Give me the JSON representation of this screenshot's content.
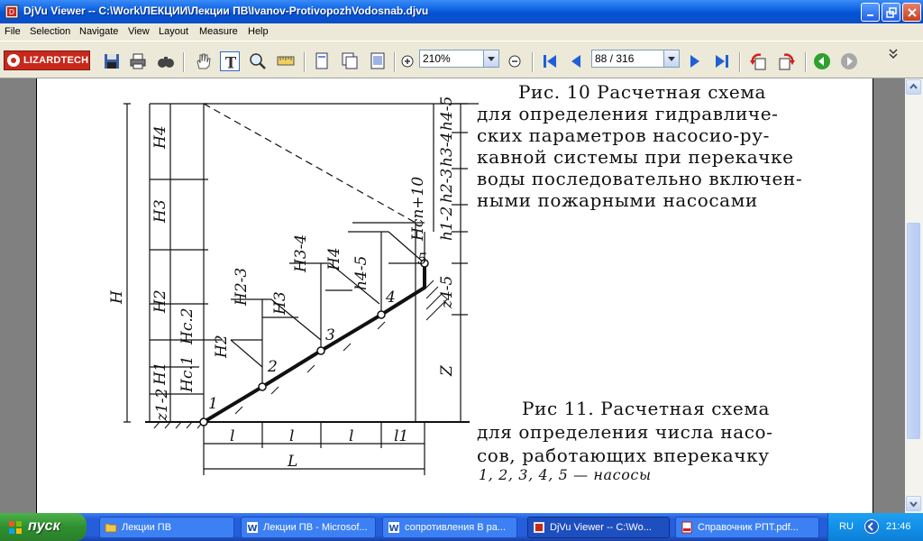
{
  "window": {
    "title": "DjVu Viewer -- C:\\Work\\ЛЕКЦИИ\\Лекции ПВ\\Ivanov-ProtivopozhVodosnab.djvu"
  },
  "menu": [
    "File",
    "Selection",
    "Navigate",
    "View",
    "Layout",
    "Measure",
    "Help"
  ],
  "toolbar": {
    "logo_text": "LIZARDTECH",
    "zoom_value": "210%",
    "page_value": "88 / 316"
  },
  "document": {
    "fig10_caption": [
      "Рис. 10  Расчетная схема",
      "для определения гидравличе-",
      "ских параметров насосио-ру-",
      "кавной системы при перекачке",
      "воды последовательно включен-",
      "ными пожарными насосами"
    ],
    "fig11_caption": [
      "Рис 11.  Расчетная схема",
      "для определения  числа насо-",
      "сов, работающих вперекачку"
    ],
    "fig11_note": "1, 2, 3, 4, 5 — насосы",
    "diagram": {
      "left_labels": [
        "H4",
        "H3",
        "H2",
        "Hc.2",
        "H1",
        "Hc.1",
        "z1-2",
        "H"
      ],
      "middle_labels": [
        "H2",
        "H2-3",
        "H3",
        "H3-4",
        "H4",
        "h4-5",
        "Hсп+10"
      ],
      "right_labels": [
        "h4-5",
        "h3-4",
        "h2-3",
        "h1-2",
        "z4-5",
        "Z"
      ],
      "pump_labels": [
        "1",
        "2",
        "3",
        "4",
        "5"
      ],
      "bottom_labels": [
        "l",
        "l",
        "l",
        "l1",
        "L"
      ]
    }
  },
  "taskbar": {
    "start_label": "пуск",
    "tasks": [
      "Лекции ПВ",
      "Лекции ПВ - Microsof...",
      "сопротивления В ра...",
      "DjVu Viewer -- C:\\Wo...",
      "Справочник РПТ.pdf..."
    ],
    "language": "RU",
    "clock": "21:46"
  },
  "colors": {
    "title_blue": "#0a5fe0",
    "taskbar_blue": "#245edb",
    "start_green": "#2f8f2f",
    "close_red": "#c8401c"
  }
}
